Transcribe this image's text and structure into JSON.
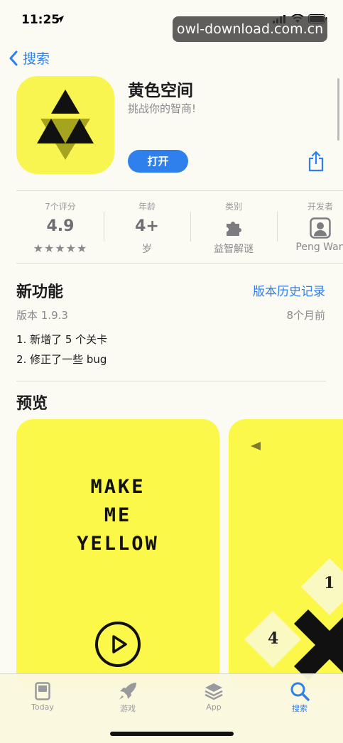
{
  "status_bar": {
    "time": "11:25"
  },
  "watermark": "owl-download.com.cn",
  "nav": {
    "back_label": "搜索"
  },
  "app": {
    "name": "黄色空间",
    "subtitle": "挑战你的智商!",
    "open_label": "打开"
  },
  "info": {
    "ratings": {
      "label": "7个评分",
      "value": "4.9",
      "stars": "★★★★★"
    },
    "age": {
      "label": "年龄",
      "value": "4+",
      "sub": "岁"
    },
    "category": {
      "label": "类别",
      "sub": "益智解谜"
    },
    "developer": {
      "label": "开发者",
      "sub": "Peng Wan"
    }
  },
  "whats_new": {
    "title": "新功能",
    "history_link": "版本历史记录",
    "version": "版本 1.9.3",
    "ago": "8个月前",
    "notes": [
      "1. 新增了 5 个关卡",
      "2. 修正了一些 bug"
    ]
  },
  "preview": {
    "title": "预览",
    "screenshot1_lines": [
      "MAKE",
      "ME",
      "YELLOW"
    ],
    "screenshot2_tiles": [
      "1",
      "4"
    ]
  },
  "tabbar": {
    "items": [
      {
        "label": "Today",
        "icon": "today-icon"
      },
      {
        "label": "游戏",
        "icon": "rocket-icon"
      },
      {
        "label": "App",
        "icon": "layers-icon"
      },
      {
        "label": "搜索",
        "icon": "search-icon",
        "active": true
      }
    ]
  },
  "colors": {
    "accent": "#2f80ed",
    "app_yellow": "#fbf84a"
  }
}
